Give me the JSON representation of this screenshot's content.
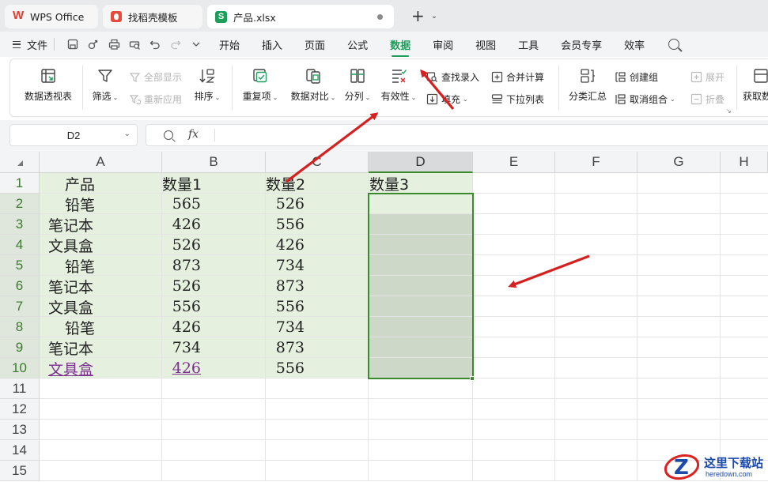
{
  "tabs": [
    {
      "label": "WPS Office"
    },
    {
      "label": "找稻壳模板"
    },
    {
      "label": "产品.xlsx"
    }
  ],
  "menu": {
    "file_label": "文件",
    "items": [
      "开始",
      "插入",
      "页面",
      "公式",
      "数据",
      "审阅",
      "视图",
      "工具",
      "会员专享",
      "效率"
    ],
    "active": "数据"
  },
  "ribbon": {
    "pivot": "数据透视表",
    "filter": "筛选",
    "show_all": "全部显示",
    "reapply": "重新应用",
    "sort": "排序",
    "dup": "重复项",
    "compare": "数据对比",
    "split": "分列",
    "validity": "有效性",
    "lookup": "查找录入",
    "fill": "填充",
    "merge_calc": "合并计算",
    "dropdown": "下拉列表",
    "subtotal": "分类汇总",
    "create_group": "创建组",
    "ungroup": "取消组合",
    "expand": "展开",
    "collapse": "折叠",
    "get_data": "获取数"
  },
  "formula_bar": {
    "cell_ref": "D2",
    "fx": "fx",
    "formula": ""
  },
  "columns": [
    "A",
    "B",
    "C",
    "D",
    "E",
    "F",
    "G",
    "H"
  ],
  "rows": [
    "1",
    "2",
    "3",
    "4",
    "5",
    "6",
    "7",
    "8",
    "9",
    "10",
    "11",
    "12",
    "13",
    "14",
    "15"
  ],
  "sheet": {
    "header": [
      "产品",
      "数量1",
      "数量2",
      "数量3"
    ],
    "data": [
      [
        "铅笔",
        "565",
        "526"
      ],
      [
        "笔记本",
        "426",
        "556"
      ],
      [
        "文具盒",
        "526",
        "426"
      ],
      [
        "铅笔",
        "873",
        "734"
      ],
      [
        "笔记本",
        "526",
        "873"
      ],
      [
        "文具盒",
        "556",
        "556"
      ],
      [
        "铅笔",
        "426",
        "734"
      ],
      [
        "笔记本",
        "734",
        "873"
      ],
      [
        "文具盒",
        "426",
        "556"
      ]
    ]
  },
  "watermark": {
    "name": "这里下载站",
    "url": "heredown.com"
  },
  "colors": {
    "accent": "#1e9e5a",
    "selection": "#3c8a2e",
    "data_fill": "#e5f0df",
    "arrow": "#d61f1f"
  }
}
